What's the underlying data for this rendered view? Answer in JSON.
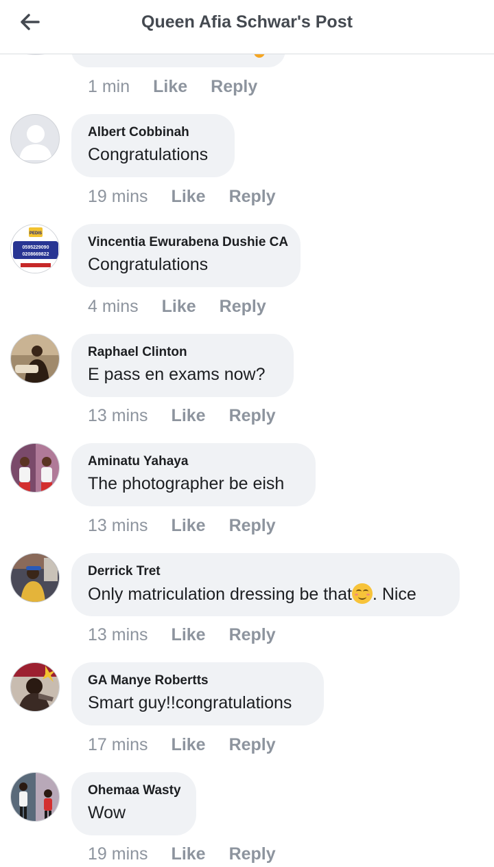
{
  "header": {
    "title": "Queen Afia Schwar's Post"
  },
  "previous_comment": {
    "time": "1 min",
    "like": "Like",
    "reply": "Reply"
  },
  "comments": [
    {
      "author": "Albert Cobbinah",
      "text": "Congratulations",
      "time": "19 mins",
      "like": "Like",
      "reply": "Reply",
      "avatar": "default-avatar"
    },
    {
      "author": "Vincentia Ewurabena Dushie CA",
      "text": "Congratulations",
      "time": "4 mins",
      "like": "Like",
      "reply": "Reply",
      "avatar": "logo-avatar",
      "avatar_text": [
        "PEDIS",
        "0595229090",
        "0208669822"
      ]
    },
    {
      "author": "Raphael Clinton",
      "text": "E pass en exams now?",
      "time": "13 mins",
      "like": "Like",
      "reply": "Reply",
      "avatar": "photo-avatar"
    },
    {
      "author": "Aminatu Yahaya",
      "text": "The photographer be eish",
      "time": "13 mins",
      "like": "Like",
      "reply": "Reply",
      "avatar": "photo-avatar"
    },
    {
      "author": "Derrick Tret",
      "text_before": "Only matriculation dressing be that",
      "text_after": ". Nice",
      "emoji": "smiling-face-emoji",
      "time": "13 mins",
      "like": "Like",
      "reply": "Reply",
      "avatar": "photo-avatar"
    },
    {
      "author": "GA Manye Robertts",
      "text": "Smart guy!!congratulations",
      "time": "17 mins",
      "like": "Like",
      "reply": "Reply",
      "avatar": "photo-avatar"
    },
    {
      "author": "Ohemaa Wasty",
      "text": "Wow",
      "time": "19 mins",
      "like": "Like",
      "reply": "Reply",
      "avatar": "photo-avatar"
    }
  ],
  "colors": {
    "bubble": "#f0f2f5",
    "meta": "#8d949e",
    "title": "#444950",
    "text": "#1c1e21"
  }
}
